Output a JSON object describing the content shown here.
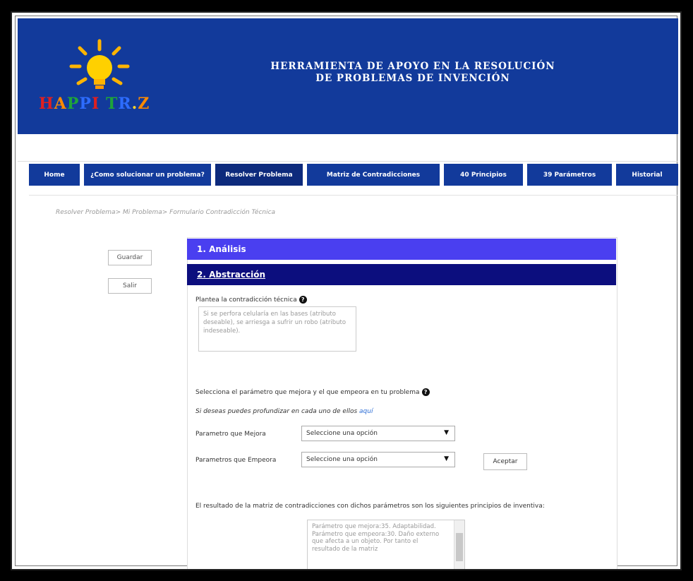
{
  "header": {
    "logo_text": "HAPPI TR.Z",
    "title_line1": "HERRAMIENTA DE APOYO EN LA RESOLUCIÓN",
    "title_line2": "DE PROBLEMAS DE INVENCIÓN"
  },
  "nav": {
    "items": [
      {
        "label": "Home"
      },
      {
        "label": "¿Como solucionar un problema?"
      },
      {
        "label": "Resolver Problema"
      },
      {
        "label": "Matriz de Contradicciones"
      },
      {
        "label": "40 Principios"
      },
      {
        "label": "39 Parámetros"
      },
      {
        "label": "Historial"
      }
    ]
  },
  "breadcrumb": "Resolver Problema> Mi Problema> Formulario Contradicción Técnica",
  "side": {
    "save_label": "Guardar",
    "exit_label": "Salir"
  },
  "accordion": {
    "section1": "1. Análisis",
    "section2": "2. Abstracción"
  },
  "form": {
    "contradiction_label": "Plantea la contradicción técnica",
    "contradiction_placeholder": "Si se perfora celularía en las bases (atributo deseable), se arriesga a sufrir un robo (atributo indeseable).",
    "select_params_label": "Selecciona el parámetro que mejora y el que empeora en tu problema",
    "deepen_text": "Si deseas puedes profundizar en cada uno de ellos",
    "deepen_link": "aquí",
    "improve_label": "Parametro que Mejora",
    "improve_value": "Seleccione una opción",
    "worsen_label": "Parametros que Empeora",
    "worsen_value": "Seleccione una opción",
    "accept_label": "Aceptar",
    "result_label": "El resultado de la matriz de contradicciones con dichos parámetros son los siguientes principios de inventiva:",
    "result_text": "Parámetro que mejora:35. Adaptabilidad. Parámetro que empeora:30. Daño externo que afecta a un objeto. Por tanto el resultado de la matriz"
  }
}
